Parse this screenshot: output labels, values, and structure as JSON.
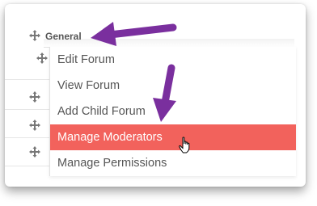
{
  "forum_tree": {
    "category_label": "General"
  },
  "context_menu": {
    "items": [
      {
        "label": "Edit Forum"
      },
      {
        "label": "View Forum"
      },
      {
        "label": "Add Child Forum"
      },
      {
        "label": "Manage Moderators"
      },
      {
        "label": "Manage Permissions"
      }
    ],
    "active_index": 3
  },
  "annotations": {
    "arrow_color": "#7a2f9e"
  },
  "colors": {
    "active_item": "#f2625c",
    "text": "#555555"
  }
}
